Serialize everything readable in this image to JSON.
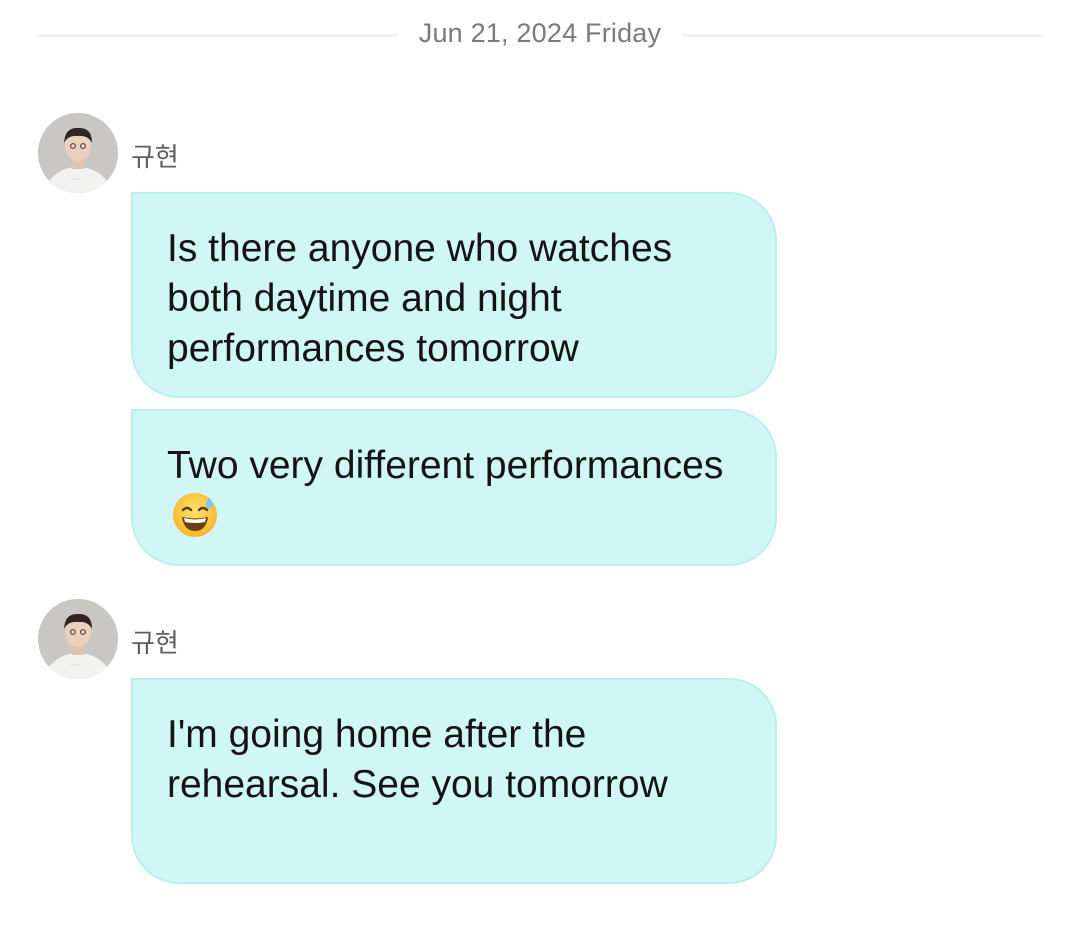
{
  "date_divider": {
    "text": "Jun 21, 2024 Friday"
  },
  "messages": [
    {
      "sender": "규현",
      "avatar_icon": "profile-photo",
      "bubbles": [
        {
          "text": "Is there anyone who watches both daytime and night performances tomorrow"
        },
        {
          "text": "Two very different performances",
          "emoji_icon": "grinning-face-with-sweat-emoji"
        }
      ]
    },
    {
      "sender": "규현",
      "avatar_icon": "profile-photo",
      "bubbles": [
        {
          "text": "I'm going home after the rehearsal. See you tomorrow"
        }
      ]
    }
  ],
  "colors": {
    "bubble_background": "#d1f6f6",
    "bubble_border": "#bdeeee",
    "divider": "#f1f1f1",
    "muted_text": "#7a7a7a"
  }
}
